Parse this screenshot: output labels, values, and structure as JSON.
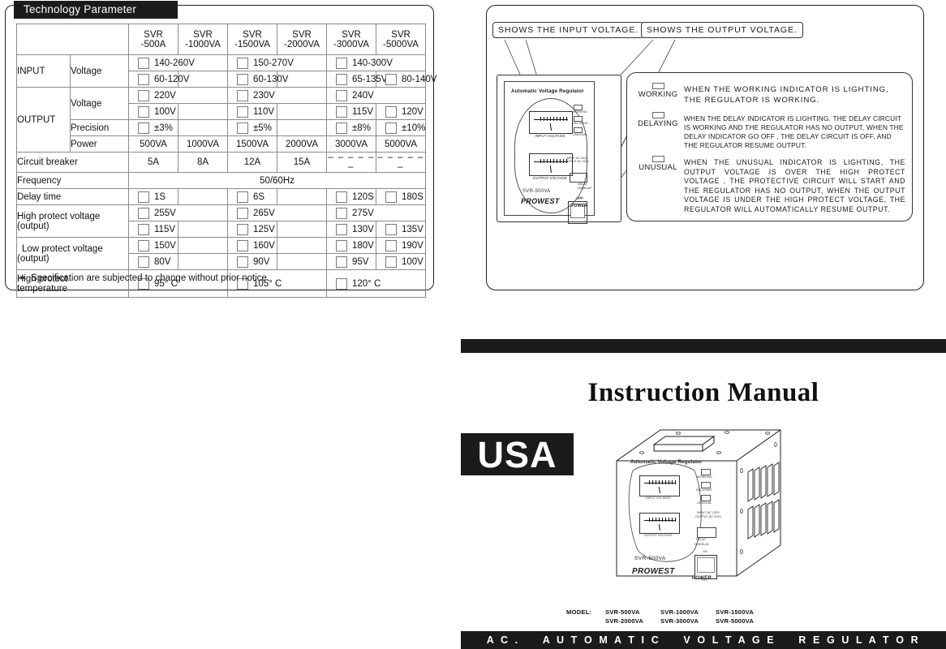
{
  "spec": {
    "title": "Technology Parameter",
    "note_star": "∗",
    "note": "Specification are subjected to change without prior notice.",
    "model_label": "MODEL",
    "models": [
      "SVR\n-500A",
      "SVR\n-1000VA",
      "SVR\n-1500VA",
      "SVR\n-2000VA",
      "SVR\n-3000VA",
      "SVR\n-5000VA"
    ],
    "model_brand": "SVR",
    "model_codes": [
      "-500A",
      "-1000VA",
      "-1500VA",
      "-2000VA",
      "-3000VA",
      "-5000VA"
    ],
    "rows": {
      "input": "INPUT",
      "output": "OUTPUT",
      "voltage": "Voltage",
      "precision": "Precision",
      "power": "Power",
      "circuit_breaker": "Circuit breaker",
      "frequency": "Frequency",
      "delay_time": "Delay  time",
      "high_protect_voltage": "High protect voltage",
      "high_protect_voltage_sub": "(output)",
      "low_protect_voltage": "Low protect voltage",
      "low_protect_voltage_sub": "(output)",
      "high_protect_temp": "High protect",
      "high_protect_temp_sub": "temperature"
    },
    "input_voltage_row1": [
      "140-260V",
      "150-270V",
      "140-300V"
    ],
    "input_voltage_row2": [
      "60-120V",
      "60-130V",
      "65-135V",
      "80-140V"
    ],
    "output_voltage_row1": [
      "220V",
      "230V",
      "240V"
    ],
    "output_voltage_row2": [
      "100V",
      "110V",
      "115V",
      "120V"
    ],
    "precision": [
      "±3%",
      "±5%",
      "±8%",
      "±10%"
    ],
    "power": [
      "500VA",
      "1000VA",
      "1500VA",
      "2000VA",
      "3000VA",
      "5000VA"
    ],
    "circuit_breaker": [
      "5A",
      "8A",
      "12A",
      "15A",
      "– – – – – –",
      "– – – – – –"
    ],
    "frequency_value": "50/60Hz",
    "delay_time": [
      "1S",
      "6S",
      "120S",
      "180S"
    ],
    "high_protect_row1": [
      "255V",
      "265V",
      "275V"
    ],
    "high_protect_row2": [
      "115V",
      "125V",
      "130V",
      "135V"
    ],
    "low_protect_row1": [
      "150V",
      "160V",
      "180V",
      "190V"
    ],
    "low_protect_row2": [
      "80V",
      "90V",
      "95V",
      "100V"
    ],
    "high_temp": [
      "95° C",
      "105° C",
      "120° C"
    ]
  },
  "description": {
    "callout_input": "SHOWS THE INPUT VOLTAGE.",
    "callout_output": "SHOWS THE OUTPUT VOLTAGE.",
    "indicators": [
      {
        "name": "WORKING",
        "text": "WHEN THE WORKING INDICATOR IS LIGHTING, THE REGULATOR IS WORKING."
      },
      {
        "name": "DELAYING",
        "text": "WHEN THE DELAY INDICATOR IS LIGHTING. THE DELAY CIRCUIT IS WORKING AND THE REGULATOR HAS NO OUTPUT, WHEN THE DELAY INDICATOR GO OFF , THE DELAY CIRCUIT IS OFF, AND THE REGULATOR RESUME OUTPUT."
      },
      {
        "name": "UNUSUAL",
        "text": "WHEN THE UNUSUAL INDICATOR IS LIGHTING, THE OUTPUT VOLTAGE IS OVER THE HIGH PROTECT VOLTAGE , THE PROTECTIVE CIRCUIT WILL START AND THE REGULATOR HAS NO OUTPUT, WHEN THE OUTPUT VOLTAGE IS UNDER THE HIGH PROTECT VOLTAGE, THE REGULATOR WILL AUTOMATICALLY RESUME OUTPUT."
      }
    ]
  },
  "device": {
    "panel_title": "Automatic Voltage Regulator",
    "input_meter_label": "INPUT VOLTAGE",
    "output_meter_label": "OUTPUT VOLTAGE",
    "lamp_working": "WORKING",
    "lamp_delaying": "DELAYING",
    "lamp_unusual": "UNUSUAL",
    "rating_text": "INPUT AC 220V OUTPUT AC 220V",
    "delay_label": "DELAY",
    "nodelay_label": "NODELAY",
    "switch_on": "ON",
    "switch_off": "OFF",
    "switch_power": "POWER",
    "model_text": "SVR-500VA",
    "brand": "PROWEST"
  },
  "cover": {
    "title": "Instruction  Manual",
    "badge": "USA",
    "model_key": "MODEL:",
    "models_row1": [
      "SVR-500VA",
      "SVR-1000VA",
      "SVR-1500VA"
    ],
    "models_row2": [
      "SVR-2000VA",
      "SVR-3000VA",
      "SVR-5000VA"
    ],
    "banner_ac": "A C .",
    "banner_automatic": "A U T O M A T I C",
    "banner_voltage": "V O L T A G E",
    "banner_regulator": "R E G U L A T O R"
  },
  "colors": {
    "ink": "#1b1b1b",
    "border": "#8b8b8b",
    "paper": "#ffffff"
  }
}
